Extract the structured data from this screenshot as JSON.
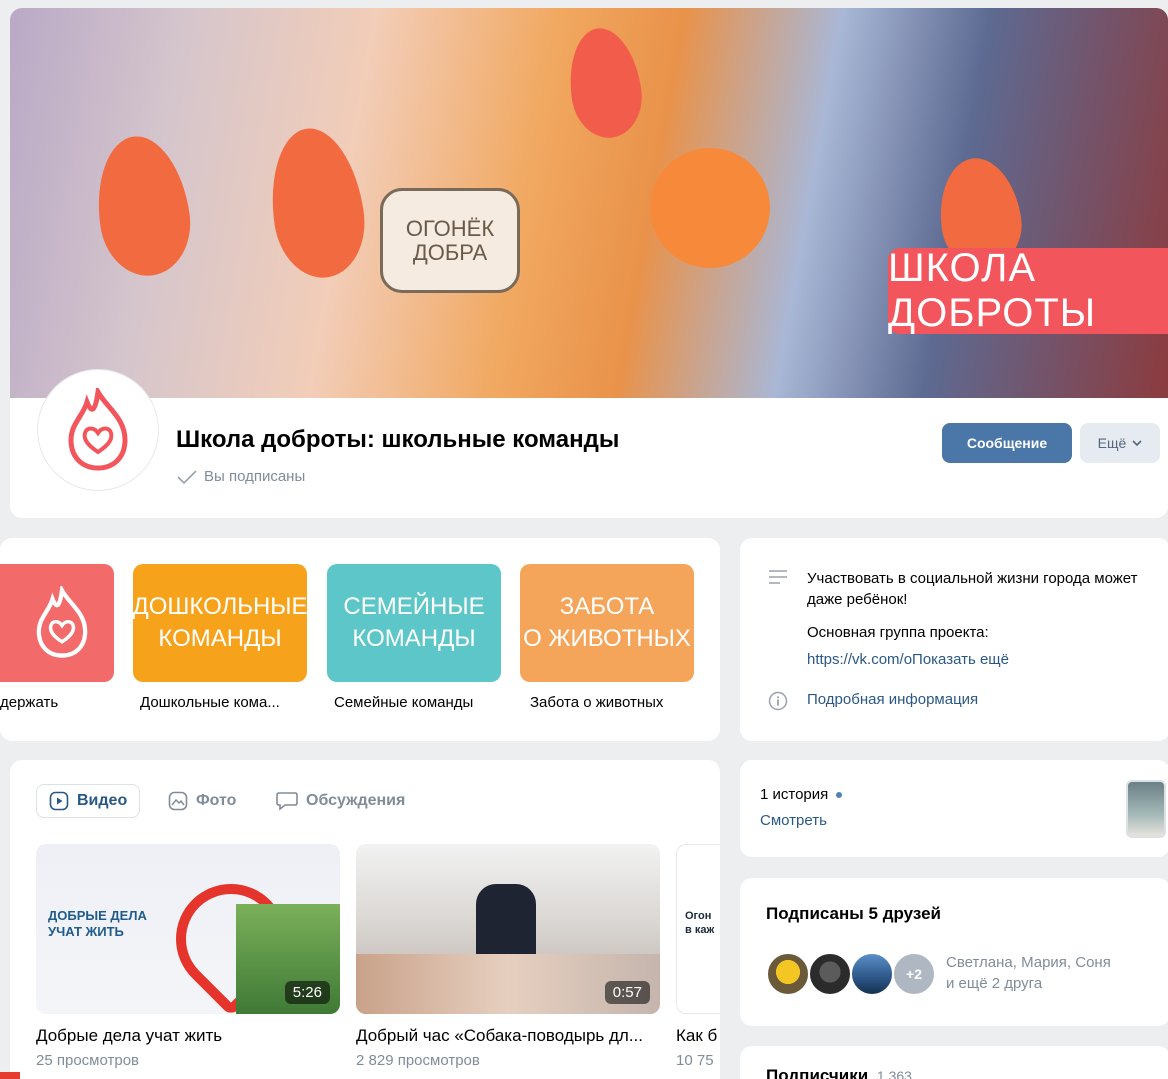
{
  "header": {
    "group_name": "Школа доброты: школьные команды",
    "subscribed_label": "Вы подписаны",
    "message_button": "Сообщение",
    "more_button": "Ещё",
    "cover_sign": "ОГОНЁК\nДОБРА",
    "cover_banner": "ШКОЛА ДОБРОТЫ"
  },
  "links": [
    {
      "tile": "",
      "label": "держать",
      "color": "#f26a6a"
    },
    {
      "tile": "ДОШКОЛЬНЫЕ\nКОМАНДЫ",
      "label": "Дошкольные кома...",
      "color": "#f7a21b"
    },
    {
      "tile": "СЕМЕЙНЫЕ\nКОМАНДЫ",
      "label": "Семейные команды",
      "color": "#5cc6c9"
    },
    {
      "tile": "ЗАБОТА\nО ЖИВОТНЫХ",
      "label": "Забота о животных",
      "color": "#f5a55a"
    }
  ],
  "about": {
    "text_line1": "Участвовать в социальной жизни города может даже ребёнок!",
    "text_line2": "Основная группа проекта:",
    "link": "https://vk.com/оПоказать ещё",
    "more_info": "Подробная информация"
  },
  "media": {
    "tabs": [
      "Видео",
      "Фото",
      "Обсуждения"
    ],
    "videos": [
      {
        "title": "Добрые дела учат жить",
        "views": "25 просмотров",
        "duration": "5:26",
        "overlay": "ДОБРЫЕ ДЕЛА\nУЧАТ ЖИТЬ"
      },
      {
        "title": "Добрый час «Собака-поводырь дл...",
        "views": "2 829 просмотров",
        "duration": "0:57"
      },
      {
        "title": "Как б",
        "views": "10 75",
        "overlay": "Огон\nв каж"
      }
    ]
  },
  "stories": {
    "count": "1 история",
    "watch": "Смотреть"
  },
  "friends": {
    "title": "Подписаны 5 друзей",
    "extra": "+2",
    "names_line1": "Светлана, Мария, Соня",
    "names_line2": "и ещё 2 друга"
  },
  "subscribers": {
    "title": "Подписчики",
    "count": "1 363"
  },
  "colors": {
    "accent": "#4a76a8",
    "link": "#2a5885",
    "muted": "#818c99"
  }
}
